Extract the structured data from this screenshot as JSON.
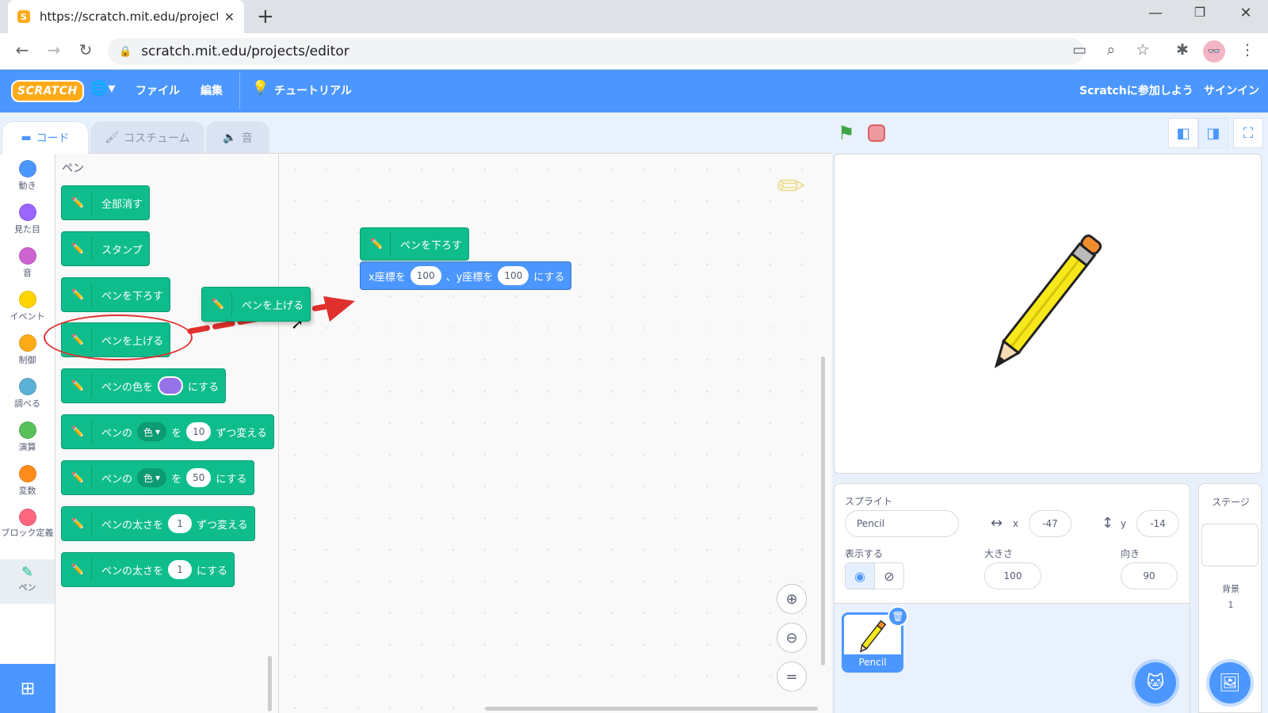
{
  "browser": {
    "tab_title": "https://scratch.mit.edu/projects/e",
    "favicon_letter": "S",
    "url": "scratch.mit.edu/projects/editor"
  },
  "menu": {
    "logo": "SCRATCH",
    "file": "ファイル",
    "edit": "編集",
    "tutorials": "チュートリアル",
    "join": "Scratchに参加しよう",
    "signin": "サインイン"
  },
  "tabs": {
    "code": "コード",
    "costumes": "コスチューム",
    "sounds": "音"
  },
  "categories": [
    {
      "label": "動き",
      "color": "#4c97ff"
    },
    {
      "label": "見た目",
      "color": "#9966ff"
    },
    {
      "label": "音",
      "color": "#cf63cf"
    },
    {
      "label": "イベント",
      "color": "#ffd500"
    },
    {
      "label": "制御",
      "color": "#ffab19"
    },
    {
      "label": "調べる",
      "color": "#5cb1d6"
    },
    {
      "label": "演算",
      "color": "#59c059"
    },
    {
      "label": "変数",
      "color": "#ff8c1a"
    },
    {
      "label": "ブロック定義",
      "color": "#ff6680"
    },
    {
      "label": "ペン",
      "color": "#0fbd8c"
    }
  ],
  "palette": {
    "title": "ペン",
    "blocks": {
      "clear": "全部消す",
      "stamp": "スタンプ",
      "pen_down": "ペンを下ろす",
      "pen_up": "ペンを上げる",
      "set_color_prefix": "ペンの色を",
      "set_color_suffix": "にする",
      "change_param_prefix": "ペンの",
      "change_param_dd": "色",
      "change_param_mid": "を",
      "change_param_value": "10",
      "change_param_suffix": "ずつ変える",
      "set_param_prefix": "ペンの",
      "set_param_dd": "色",
      "set_param_mid": "を",
      "set_param_value": "50",
      "set_param_suffix": "にする",
      "change_size_prefix": "ペンの太さを",
      "change_size_value": "1",
      "change_size_suffix": "ずつ変える",
      "set_size_prefix": "ペンの太さを",
      "set_size_value": "1",
      "set_size_suffix": "にする"
    }
  },
  "dragging_block": "ペンを上げる",
  "script": {
    "pen_down": "ペンを下ろす",
    "goto_x_label": "x座標を",
    "goto_x_value": "100",
    "goto_y_label": "、y座標を",
    "goto_y_value": "100",
    "goto_suffix": "にする"
  },
  "sprite_info": {
    "sprite_label": "スプライト",
    "sprite_name": "Pencil",
    "x_label": "x",
    "x_value": "-47",
    "y_label": "y",
    "y_value": "-14",
    "show_label": "表示する",
    "size_label": "大きさ",
    "size_value": "100",
    "direction_label": "向き",
    "direction_value": "90"
  },
  "sprite_list": [
    {
      "name": "Pencil"
    }
  ],
  "stage_pane": {
    "title": "ステージ",
    "backdrops_label": "背景",
    "backdrops_count": "1"
  },
  "colors": {
    "accent": "#4c97ff",
    "pen": "#0fbd8c",
    "annotation": "#e0302d"
  }
}
